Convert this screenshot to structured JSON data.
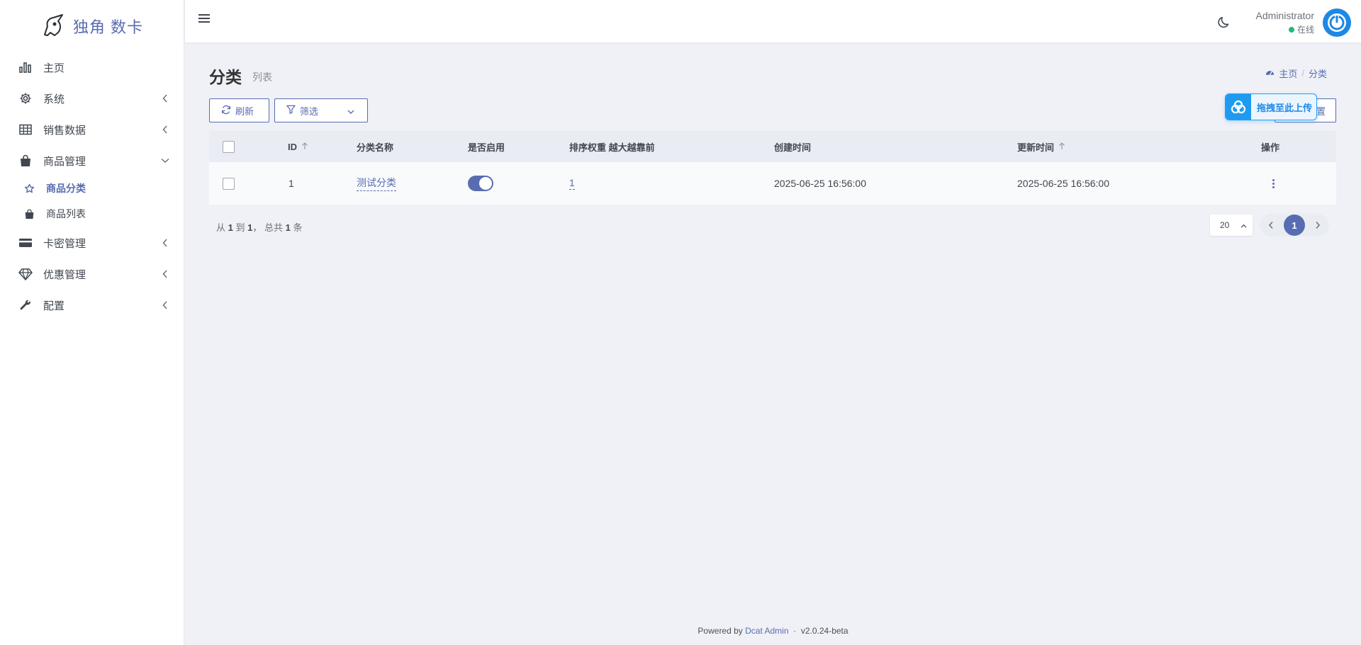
{
  "brand": {
    "name": "独角 数卡",
    "icon": "unicorn-logo"
  },
  "sidebar": {
    "items": [
      {
        "label": "主页",
        "icon": "bar-chart-icon"
      },
      {
        "label": "系统",
        "icon": "gear-icon"
      },
      {
        "label": "销售数据",
        "icon": "table-icon"
      },
      {
        "label": "商品管理",
        "icon": "shopping-bag-icon"
      },
      {
        "label": "卡密管理",
        "icon": "credit-card-icon"
      },
      {
        "label": "优惠管理",
        "icon": "diamond-icon"
      },
      {
        "label": "配置",
        "icon": "wrench-icon"
      }
    ],
    "sub_items": [
      {
        "label": "商品分类",
        "icon": "star-icon",
        "active": true
      },
      {
        "label": "商品列表",
        "icon": "shopping-bag-icon",
        "active": false
      }
    ]
  },
  "navbar": {
    "user_name": "Administrator",
    "user_status": "在线"
  },
  "page": {
    "title": "分类",
    "subtitle": "列表",
    "breadcrumb": {
      "home": "主页",
      "current": "分类"
    }
  },
  "toolbar": {
    "refresh_label": "刷新",
    "filter_label": "筛选",
    "settings_label": "置",
    "upload_label": "拖拽至此上传"
  },
  "table": {
    "headers": {
      "id": "ID",
      "name": "分类名称",
      "enabled": "是否启用",
      "order": "排序权重 越大越靠前",
      "created": "创建时间",
      "updated": "更新时间",
      "actions": "操作"
    },
    "rows": [
      {
        "id": "1",
        "name": "测试分类",
        "enabled": true,
        "order": "1",
        "created": "2025-06-25 16:56:00",
        "updated": "2025-06-25 16:56:00"
      }
    ]
  },
  "pagination": {
    "from_label": "从",
    "from": "1",
    "to_label": "到",
    "to": "1",
    "total_label": "， 总共",
    "total": "1",
    "unit": "条",
    "per_page": "20",
    "current_page": "1"
  },
  "footer": {
    "powered_by": "Powered by",
    "link": "Dcat Admin",
    "separator": "·",
    "version": "v2.0.24-beta"
  },
  "colors": {
    "primary": "#586cb1",
    "success": "#21b978",
    "upload_accent": "#1e9bf0"
  }
}
